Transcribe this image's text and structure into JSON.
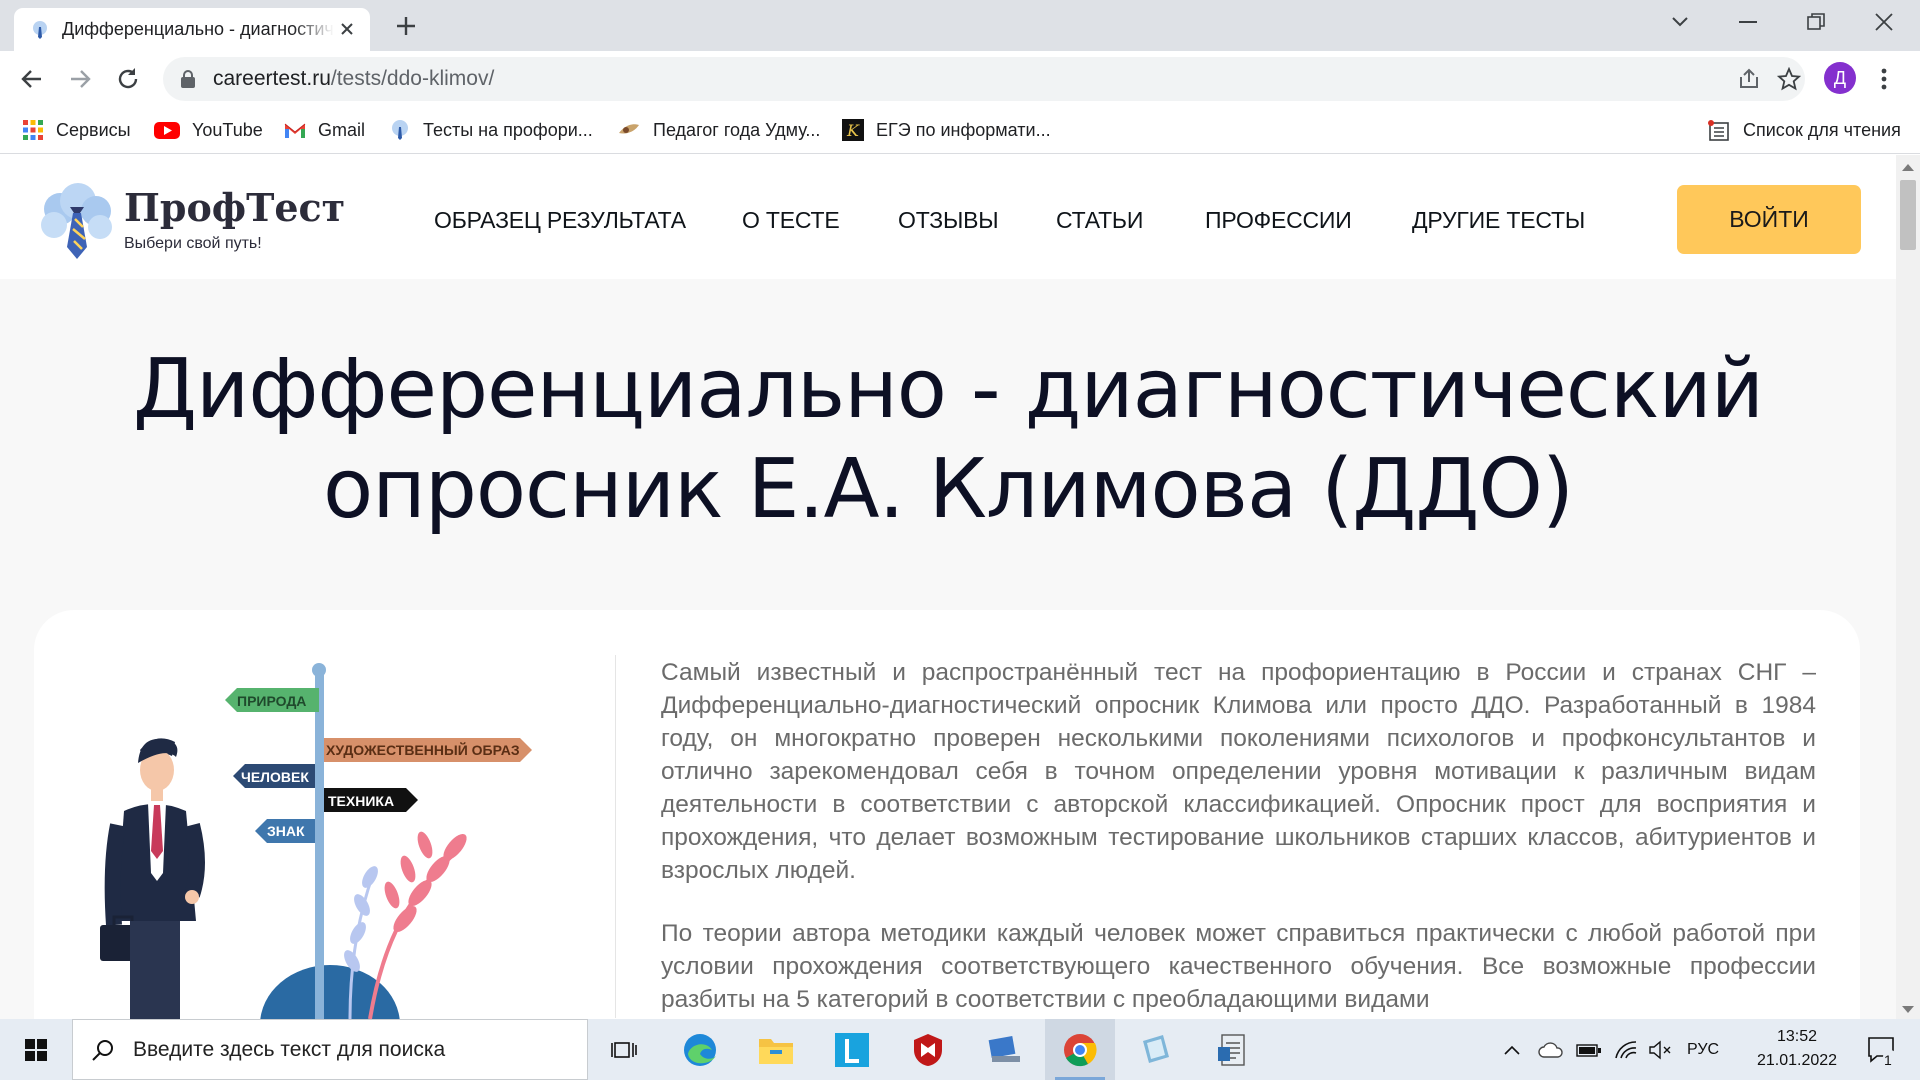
{
  "browser": {
    "tab_title": "Дифференциально - диагностический опросник Е.А. Климова (ДДО)",
    "url_domain": "careertest.ru",
    "url_path": "/tests/ddo-klimov/",
    "avatar_letter": "Д"
  },
  "bookmarks": [
    {
      "label": "Сервисы",
      "icon": "apps-grid-icon"
    },
    {
      "label": "YouTube",
      "icon": "youtube-icon"
    },
    {
      "label": "Gmail",
      "icon": "gmail-icon"
    },
    {
      "label": "Тесты на профори...",
      "icon": "proftest-favicon"
    },
    {
      "label": "Педагог года Удму...",
      "icon": "pedagog-icon"
    },
    {
      "label": "ЕГЭ по информати...",
      "icon": "k-icon"
    }
  ],
  "reading_list": "Список для чтения",
  "site": {
    "logo_name": "ПрофТест",
    "logo_tagline": "Выбери свой путь!",
    "nav": [
      "ОБРАЗЕЦ РЕЗУЛЬТАТА",
      "О ТЕСТЕ",
      "ОТЗЫВЫ",
      "СТАТЬИ",
      "ПРОФЕССИИ",
      "ДРУГИЕ ТЕСТЫ"
    ],
    "login": "ВОЙТИ",
    "title_line1": "Дифференциально - диагностический",
    "title_line2": "опросник Е.А. Климова (ДДО)"
  },
  "illustration_signs": [
    "ПРИРОДА",
    "ХУДОЖЕСТВЕННЫЙ ОБРАЗ",
    "ЧЕЛОВЕК",
    "ТЕХНИКА",
    "ЗНАК"
  ],
  "content": {
    "paragraph1": "Самый известный и распространённый тест на профориентацию в России и странах СНГ – Дифференциально-диагностический опросник Климова или просто ДДО. Разработанный в 1984 году, он многократно проверен несколькими поколениями психологов и профконсультантов и отлично зарекомендовал себя в точном определении уровня мотивации к различным видам деятельности в соответствии с авторской классификацией. Опросник прост для восприятия и прохождения, что делает возможным тестирование школьников старших классов, абитуриентов и взрослых людей.",
    "paragraph2": "По теории автора методики каждый человек может справиться практически с любой работой при условии прохождения соответствующего качественного обучения. Все возможные профессии разбиты на 5 категорий в соответствии с преобладающими видами"
  },
  "taskbar": {
    "search_placeholder": "Введите здесь текст для поиска",
    "lang": "РУС",
    "time": "13:52",
    "date": "21.01.2022",
    "notifications": "1"
  },
  "colors": {
    "accent_button": "#ffc85a",
    "title_text": "#0d1024",
    "body_text": "#6b6b6b"
  }
}
